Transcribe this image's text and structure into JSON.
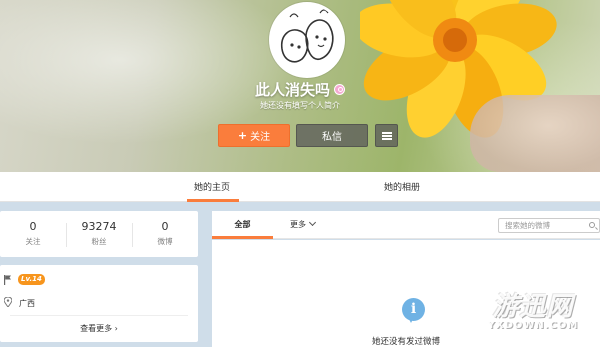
{
  "profile": {
    "name": "此人消失吗",
    "intro": "她还没有填写个人简介",
    "gender_icon": "female-icon",
    "follow_plus": "+",
    "follow_label": "关注",
    "message_label": "私信",
    "more_icon": "menu-icon"
  },
  "tabs": {
    "home": "她的主页",
    "album": "她的相册"
  },
  "stats": [
    {
      "value": "0",
      "label": "关注"
    },
    {
      "value": "93274",
      "label": "粉丝"
    },
    {
      "value": "0",
      "label": "微博"
    }
  ],
  "info": {
    "level": "Lv.14",
    "location": "广西",
    "view_more": "查看更多",
    "view_more_arrow": "›"
  },
  "feed": {
    "tab_all": "全部",
    "tab_more": "更多",
    "search_placeholder": "搜索她的微博",
    "empty_icon_glyph": "i",
    "empty_text": "她还没有发过微博"
  },
  "watermark": {
    "title": "游迅网",
    "sub": "YXDOWN.COM"
  },
  "colors": {
    "accent": "#fa7d3c",
    "info_blue": "#6fb2e4",
    "level_orange": "#f7951d",
    "page_bg": "#cfdde9"
  }
}
